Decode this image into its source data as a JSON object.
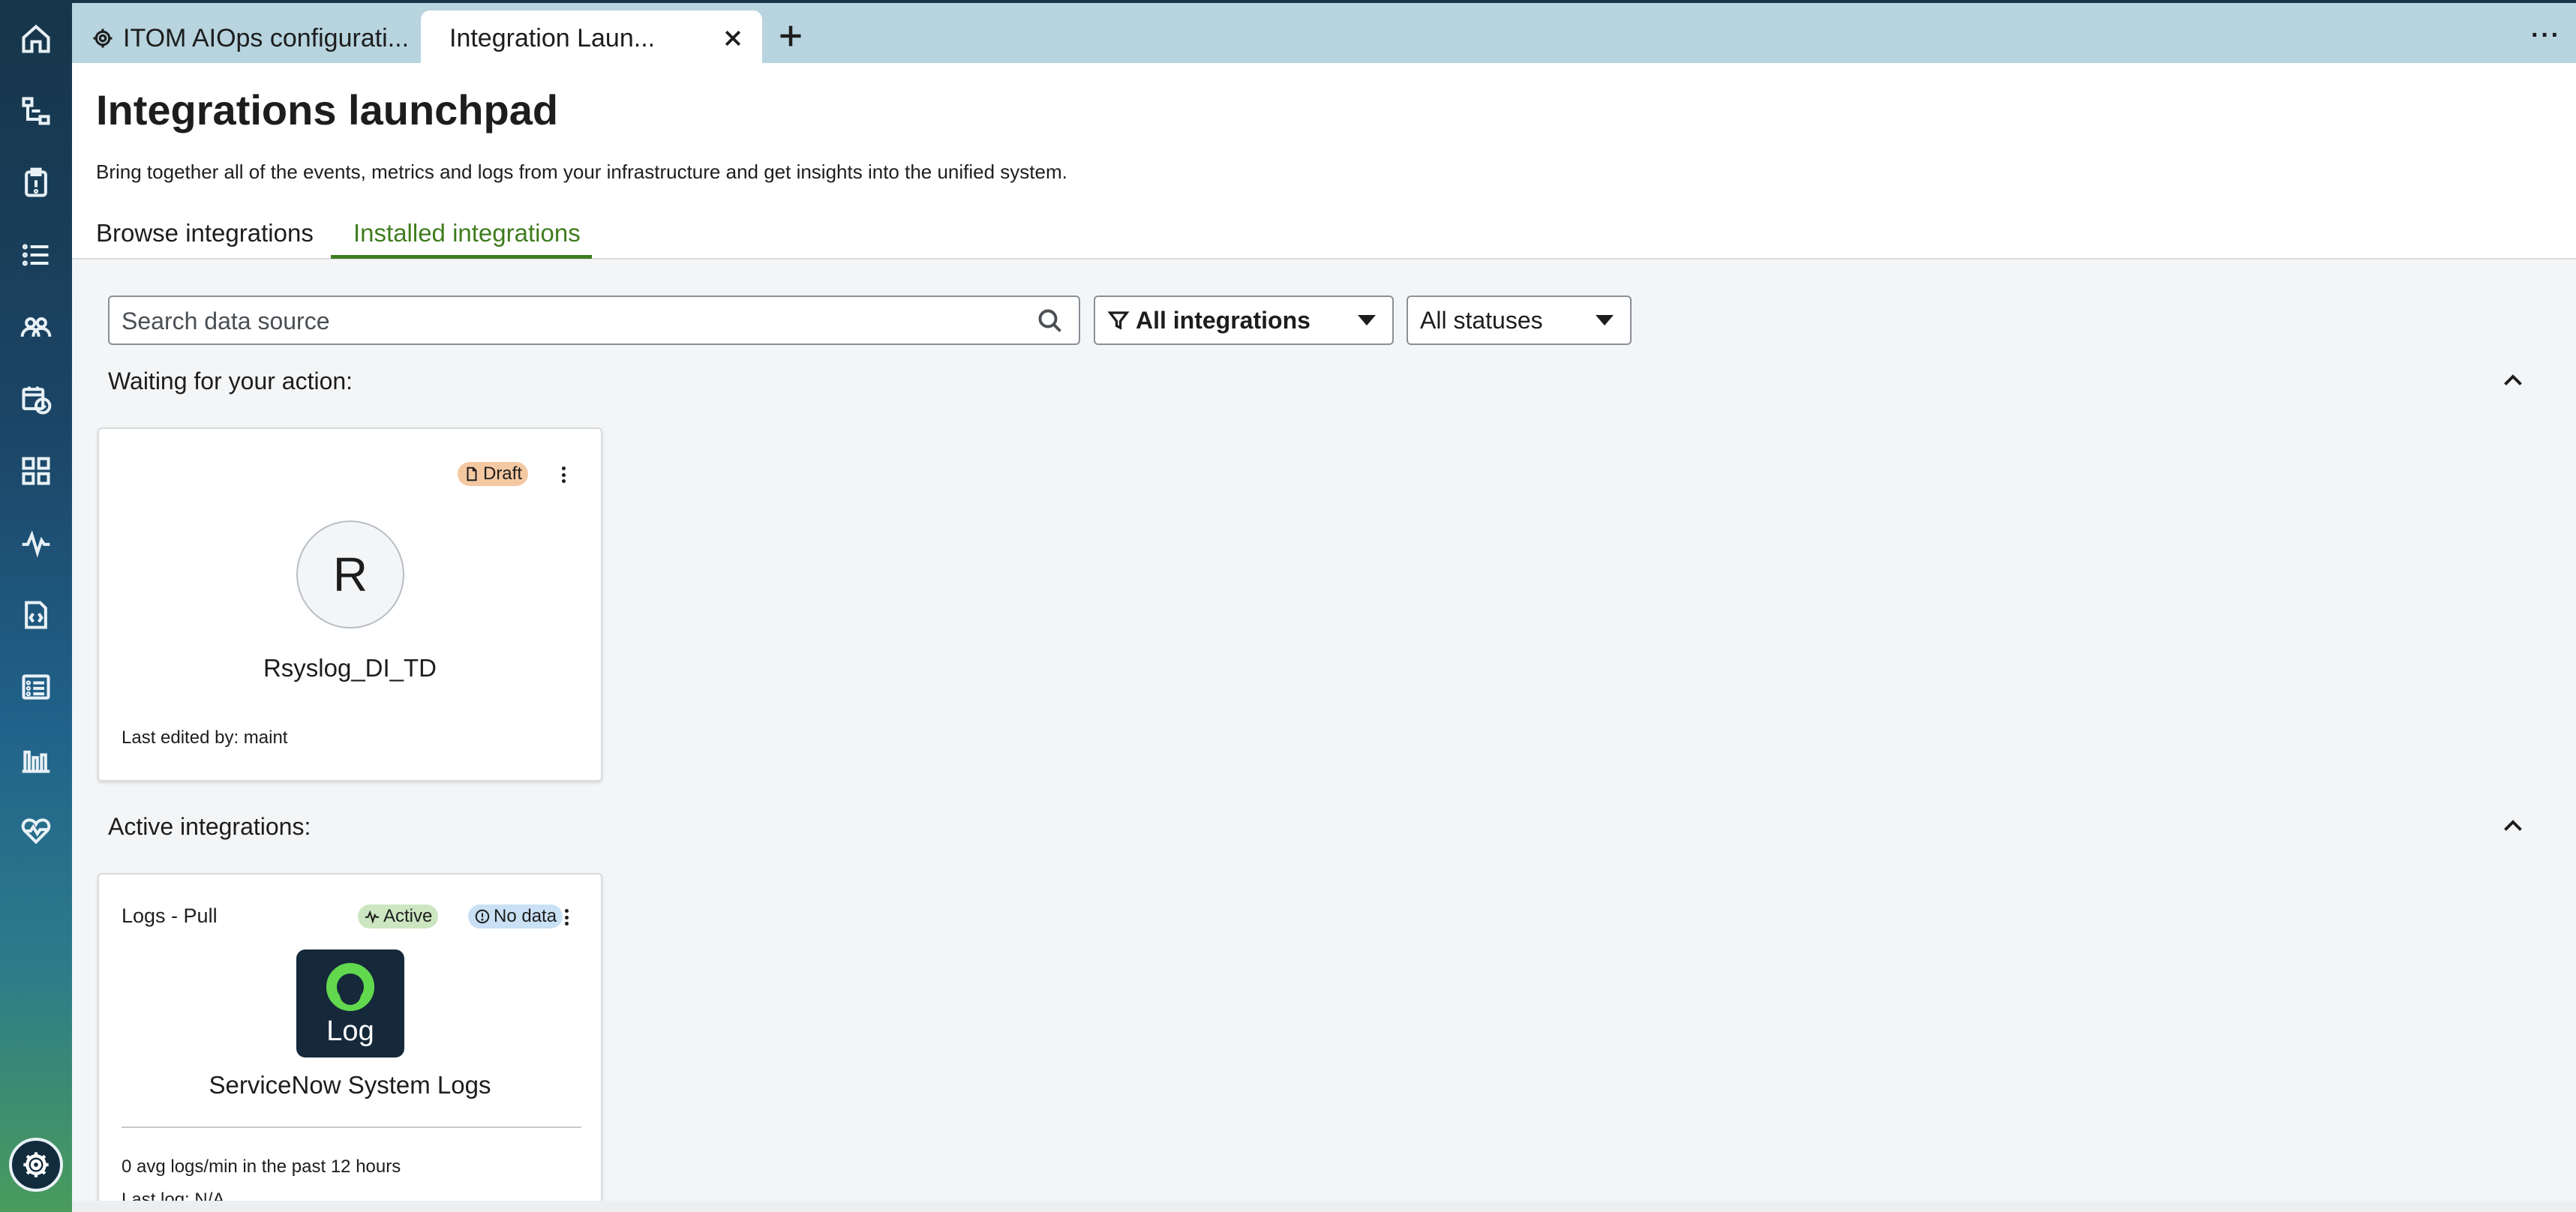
{
  "tabs": {
    "inactive_label": "ITOM AIOps configurati...",
    "active_label": "Integration Laun..."
  },
  "header": {
    "title": "Integrations launchpad",
    "subtitle": "Bring together all of the events, metrics and logs from your infrastructure and get insights into the unified system.",
    "nav": {
      "browse": "Browse integrations",
      "installed": "Installed integrations"
    }
  },
  "filters": {
    "search_placeholder": "Search data source",
    "integrations": "All integrations",
    "statuses": "All statuses"
  },
  "waiting": {
    "title": "Waiting for your action:",
    "card": {
      "badge": "Draft",
      "avatar_letter": "R",
      "name": "Rsyslog_DI_TD",
      "edited": "Last edited by: maint"
    }
  },
  "active": {
    "title": "Active integrations:",
    "card": {
      "type": "Logs - Pull",
      "badge_active": "Active",
      "badge_nodata": "No data",
      "logo_text": "Log",
      "name": "ServiceNow System Logs",
      "avg": "0 avg logs/min in the past 12 hours",
      "last_log": "Last log: N/A"
    }
  },
  "colors": {
    "accent_green": "#3f7d1f",
    "tabbar": "#b7d4df",
    "draft": "#f4c8a1",
    "active": "#cbe6c0",
    "nodata": "#c9e0f5"
  },
  "icons": {
    "rail": [
      "home-icon",
      "workflow-icon",
      "clipboard-icon",
      "list-icon",
      "users-icon",
      "calendar-clock-icon",
      "grid-icon",
      "pulse-icon",
      "code-file-icon",
      "table-list-icon",
      "bar-chart-icon",
      "heart-pulse-icon",
      "settings-icon"
    ]
  }
}
